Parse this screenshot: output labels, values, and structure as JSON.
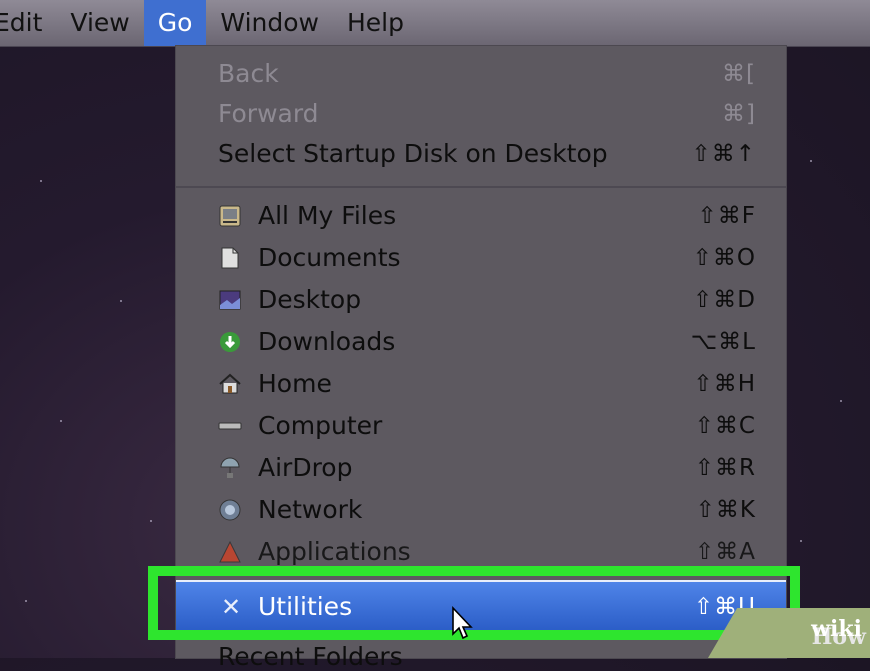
{
  "menubar": {
    "items": [
      {
        "label": "Edit",
        "active": false
      },
      {
        "label": "View",
        "active": false
      },
      {
        "label": "Go",
        "active": true
      },
      {
        "label": "Window",
        "active": false
      },
      {
        "label": "Help",
        "active": false
      }
    ]
  },
  "go_menu": {
    "back": {
      "label": "Back",
      "shortcut": "⌘[",
      "enabled": false
    },
    "forward": {
      "label": "Forward",
      "shortcut": "⌘]",
      "enabled": false
    },
    "startup_disk": {
      "label": "Select Startup Disk on Desktop",
      "shortcut": "⇧⌘↑"
    },
    "places": [
      {
        "label": "All My Files",
        "shortcut": "⇧⌘F",
        "icon": "all-my-files-icon"
      },
      {
        "label": "Documents",
        "shortcut": "⇧⌘O",
        "icon": "documents-icon"
      },
      {
        "label": "Desktop",
        "shortcut": "⇧⌘D",
        "icon": "desktop-icon"
      },
      {
        "label": "Downloads",
        "shortcut": "⌥⌘L",
        "icon": "downloads-icon"
      },
      {
        "label": "Home",
        "shortcut": "⇧⌘H",
        "icon": "home-icon"
      },
      {
        "label": "Computer",
        "shortcut": "⇧⌘C",
        "icon": "computer-icon"
      },
      {
        "label": "AirDrop",
        "shortcut": "⇧⌘R",
        "icon": "airdrop-icon"
      },
      {
        "label": "Network",
        "shortcut": "⇧⌘K",
        "icon": "network-icon"
      },
      {
        "label": "Applications",
        "shortcut": "⇧⌘A",
        "icon": "applications-icon"
      }
    ],
    "utilities": {
      "label": "Utilities",
      "shortcut": "⇧⌘U",
      "icon": "utilities-icon"
    },
    "recent_folders": {
      "label": "Recent Folders"
    }
  },
  "watermark": {
    "wiki": "wiki",
    "how": "How"
  },
  "colors": {
    "highlight": "#3f6fd0",
    "annotation": "#2ee52e"
  }
}
